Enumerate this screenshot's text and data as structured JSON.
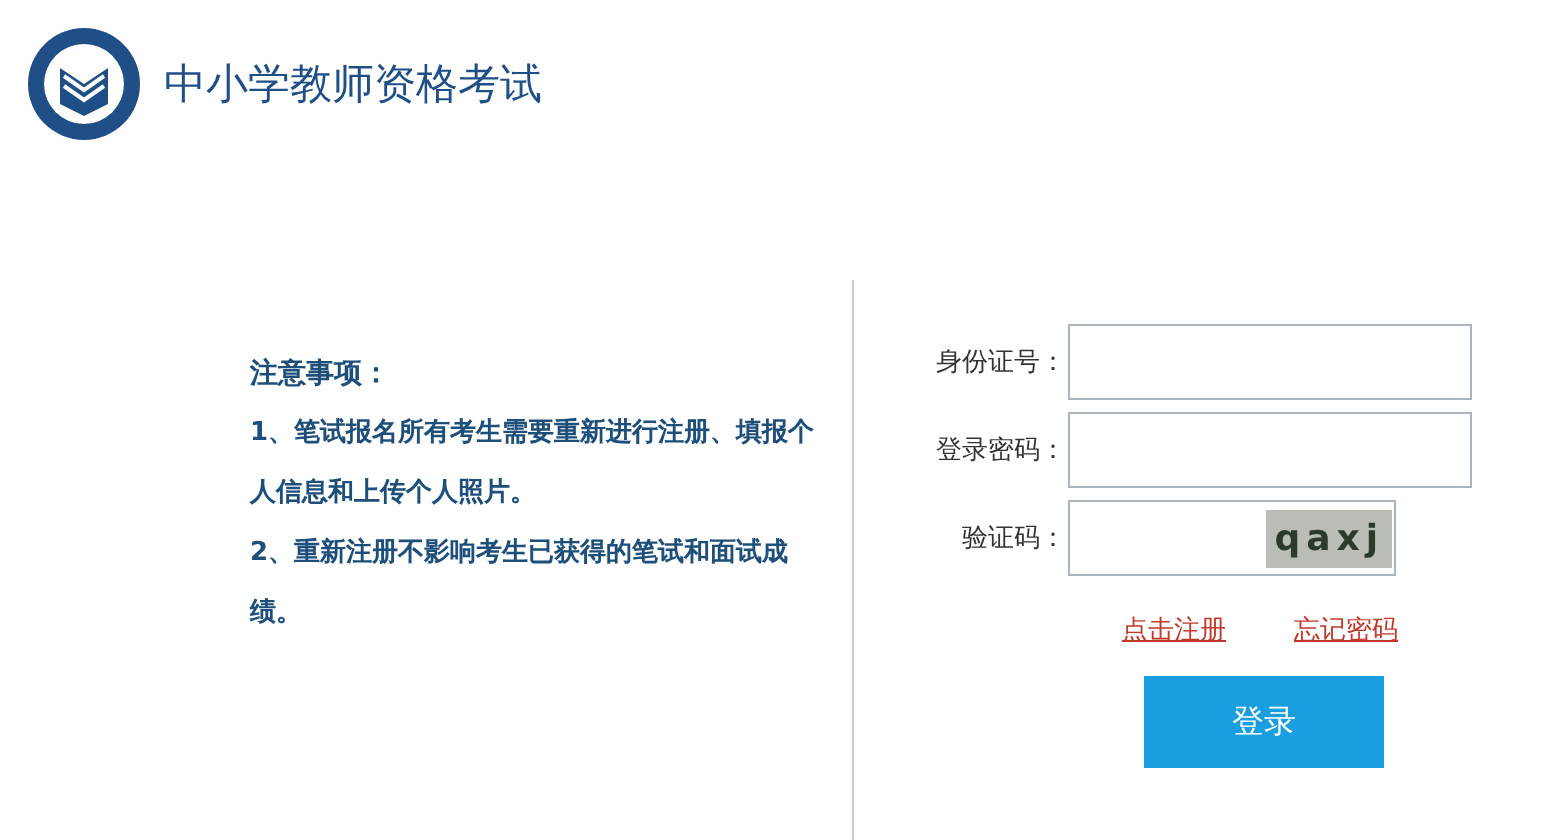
{
  "header": {
    "title": "中小学教师资格考试"
  },
  "notice": {
    "heading": "注意事项：",
    "items": [
      "1、笔试报名所有考生需要重新进行注册、填报个人信息和上传个人照片。",
      "2、重新注册不影响考生已获得的笔试和面试成绩。"
    ]
  },
  "form": {
    "fields": [
      {
        "label": "身份证号：",
        "kind": "text"
      },
      {
        "label": "登录密码：",
        "kind": "password"
      },
      {
        "label": "验证码：",
        "kind": "captcha",
        "captcha": "qaxj"
      }
    ],
    "links": [
      "点击注册",
      "忘记密码"
    ],
    "submit": "登录"
  }
}
